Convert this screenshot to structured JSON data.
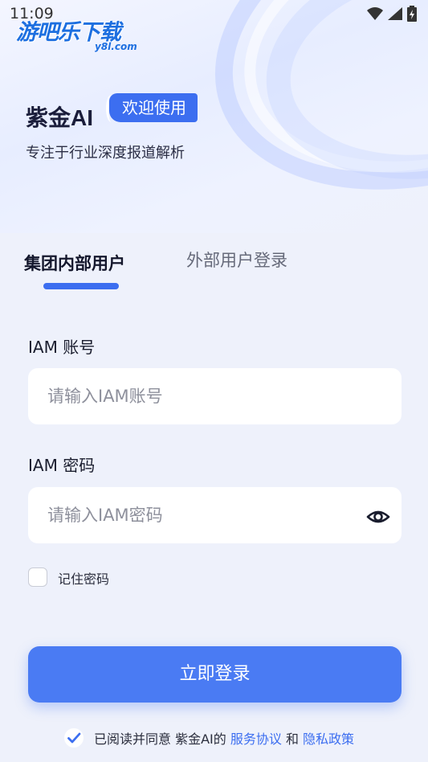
{
  "status_bar": {
    "time": "11:09"
  },
  "watermark": {
    "main": "游吧乐下载",
    "sub": "y8l.com"
  },
  "brand": {
    "name": "紫金AI",
    "welcome": "欢迎使用",
    "tagline": "专注于行业深度报道解析"
  },
  "tabs": [
    {
      "label": "集团内部用户",
      "active": true
    },
    {
      "label": "外部用户登录",
      "active": false
    }
  ],
  "form": {
    "account_label": "IAM 账号",
    "account_placeholder": "请输入IAM账号",
    "password_label": "IAM 密码",
    "password_placeholder": "请输入IAM密码",
    "remember_label": "记住密码",
    "remember_checked": false
  },
  "login_button": "立即登录",
  "agreement": {
    "prefix": "已阅读并同意 紫金AI的 ",
    "service_link": "服务协议",
    "and": " 和 ",
    "privacy_link": "隐私政策",
    "checked": true
  },
  "colors": {
    "accent": "#3c6ef0",
    "button": "#4a7bf3",
    "background": "#eef1fb"
  }
}
